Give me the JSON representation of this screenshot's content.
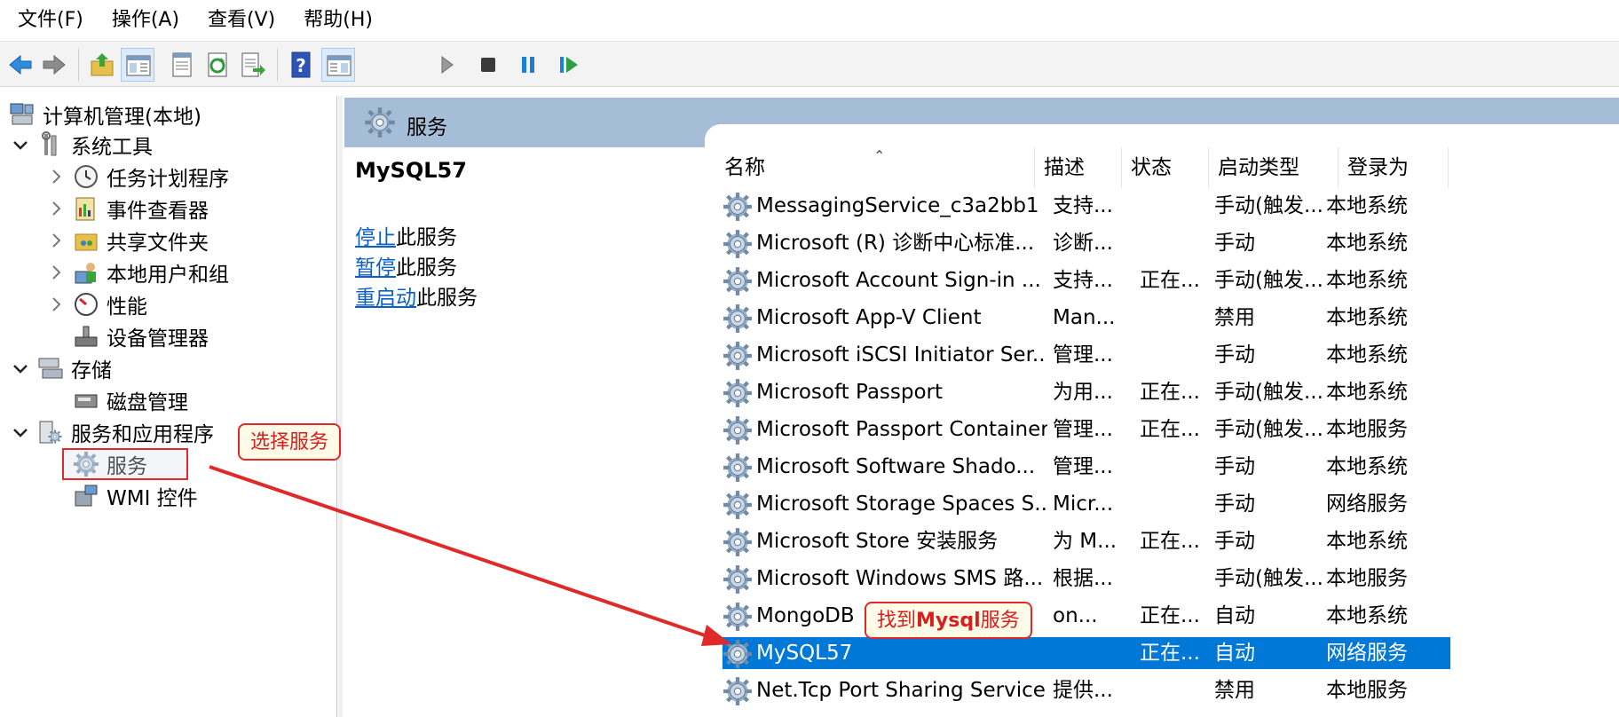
{
  "menu": [
    "文件(F)",
    "操作(A)",
    "查看(V)",
    "帮助(H)"
  ],
  "toolbar": [
    "back-icon",
    "forward-icon",
    "up-folder-icon",
    "show-hide-tree-icon",
    "properties-icon",
    "refresh-icon",
    "export-icon",
    "help-icon",
    "console-icon",
    "start-icon",
    "stop-icon",
    "pause-icon",
    "resume-icon"
  ],
  "tree": {
    "root": "计算机管理(本地)",
    "system_tools": "系统工具",
    "task_scheduler": "任务计划程序",
    "event_viewer": "事件查看器",
    "shared_folders": "共享文件夹",
    "local_users": "本地用户和组",
    "performance": "性能",
    "device_manager": "设备管理器",
    "storage": "存储",
    "disk_management": "磁盘管理",
    "services_apps": "服务和应用程序",
    "services": "服务",
    "wmi": "WMI 控件"
  },
  "header": {
    "title": "服务"
  },
  "detail": {
    "service_name": "MySQL57",
    "stop_link": "停止",
    "stop_suffix": "此服务",
    "pause_link": "暂停",
    "pause_suffix": "此服务",
    "restart_link": "重启动",
    "restart_suffix": "此服务"
  },
  "columns": {
    "name": "名称",
    "desc": "描述",
    "status": "状态",
    "startup": "启动类型",
    "logon": "登录为"
  },
  "rows": [
    {
      "name": "MessagingService_c3a2bb1",
      "desc": "支持...",
      "status": "",
      "startup": "手动(触发...",
      "logon": "本地系统"
    },
    {
      "name": "Microsoft (R) 诊断中心标准...",
      "desc": "诊断...",
      "status": "",
      "startup": "手动",
      "logon": "本地系统"
    },
    {
      "name": "Microsoft Account Sign-in ...",
      "desc": "支持...",
      "status": "正在...",
      "startup": "手动(触发...",
      "logon": "本地系统"
    },
    {
      "name": "Microsoft App-V Client",
      "desc": "Man...",
      "status": "",
      "startup": "禁用",
      "logon": "本地系统"
    },
    {
      "name": "Microsoft iSCSI Initiator Ser...",
      "desc": "管理...",
      "status": "",
      "startup": "手动",
      "logon": "本地系统"
    },
    {
      "name": "Microsoft Passport",
      "desc": "为用...",
      "status": "正在...",
      "startup": "手动(触发...",
      "logon": "本地系统"
    },
    {
      "name": "Microsoft Passport Container",
      "desc": "管理...",
      "status": "正在...",
      "startup": "手动(触发...",
      "logon": "本地服务"
    },
    {
      "name": "Microsoft Software Shado...",
      "desc": "管理...",
      "status": "",
      "startup": "手动",
      "logon": "本地系统"
    },
    {
      "name": "Microsoft Storage Spaces S...",
      "desc": "Micr...",
      "status": "",
      "startup": "手动",
      "logon": "网络服务"
    },
    {
      "name": "Microsoft Store 安装服务",
      "desc": "为 M...",
      "status": "正在...",
      "startup": "手动",
      "logon": "本地系统"
    },
    {
      "name": "Microsoft Windows SMS 路...",
      "desc": "根据...",
      "status": "",
      "startup": "手动(触发...",
      "logon": "本地服务"
    },
    {
      "name": "MongoDB",
      "desc": "on...",
      "status": "正在...",
      "startup": "自动",
      "logon": "本地系统"
    },
    {
      "name": "MySQL57",
      "desc": "",
      "status": "正在...",
      "startup": "自动",
      "logon": "网络服务"
    },
    {
      "name": "Net.Tcp Port Sharing Service",
      "desc": "提供...",
      "status": "",
      "startup": "禁用",
      "logon": "本地服务"
    }
  ],
  "callouts": {
    "select_service": "选择服务",
    "find_mysql_prefix": "找到",
    "find_mysql_bold": "Mysql",
    "find_mysql_suffix": "服务"
  },
  "colors": {
    "header_bg": "#a6bdd7",
    "selected_row": "#0078d7",
    "link": "#0b5fc7",
    "annotation_red": "#e02a2a"
  }
}
